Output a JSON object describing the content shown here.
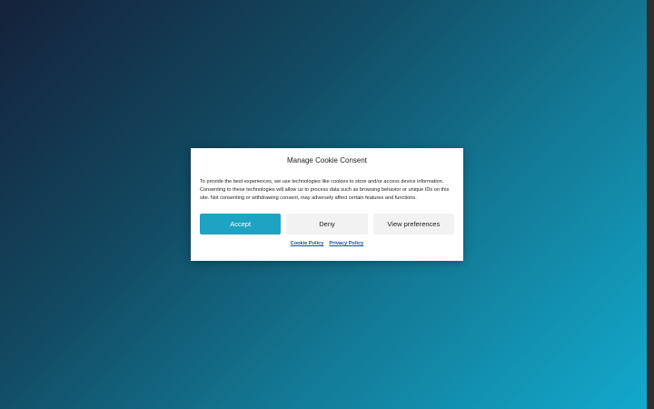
{
  "consent": {
    "title": "Manage Cookie Consent",
    "message": "To provide the best experiences, we use technologies like cookies to store and/or access device information. Consenting to these technologies will allow us to process data such as browsing behavior or unique IDs on this site. Not consenting or withdrawing consent, may adversely affect certain features and functions.",
    "accept_label": "Accept",
    "deny_label": "Deny",
    "preferences_label": "View preferences",
    "links": {
      "cookie_policy": "Cookie Policy",
      "privacy_policy": "Privacy Policy"
    }
  },
  "colors": {
    "accent": "#1ea3c2",
    "link": "#1a4f8f",
    "button_secondary": "#f2f2f2"
  }
}
